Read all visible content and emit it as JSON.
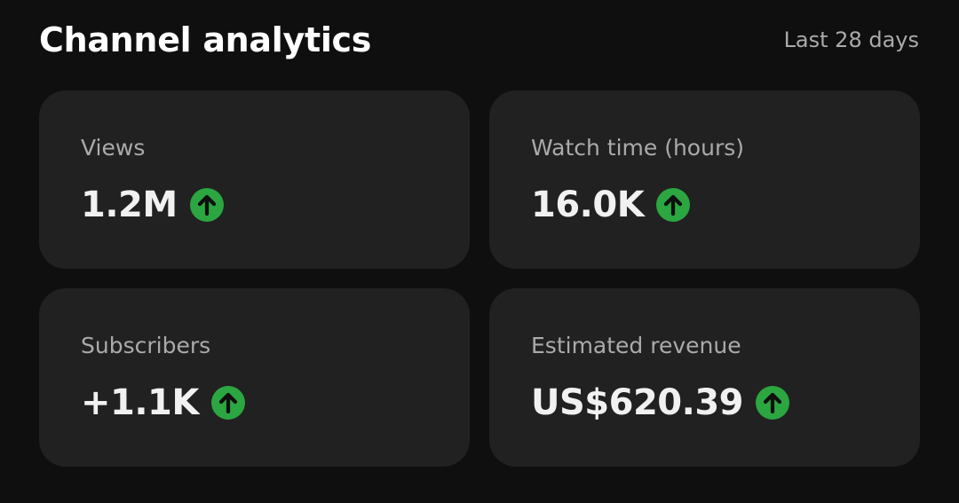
{
  "header": {
    "title": "Channel analytics",
    "range": "Last 28 days"
  },
  "colors": {
    "background": "#0f0f0f",
    "card": "#212121",
    "label": "#aaaaaa",
    "value": "#f1f1f1",
    "trend_up": "#2ba640"
  },
  "cards": [
    {
      "label": "Views",
      "value": "1.2M",
      "trend": "up",
      "trend_icon": "arrow-up-circle-icon"
    },
    {
      "label": "Watch time (hours)",
      "value": "16.0K",
      "trend": "up",
      "trend_icon": "arrow-up-circle-icon"
    },
    {
      "label": "Subscribers",
      "value": "+1.1K",
      "trend": "up",
      "trend_icon": "arrow-up-circle-icon"
    },
    {
      "label": "Estimated revenue",
      "value": "US$620.39",
      "trend": "up",
      "trend_icon": "arrow-up-circle-icon"
    }
  ]
}
